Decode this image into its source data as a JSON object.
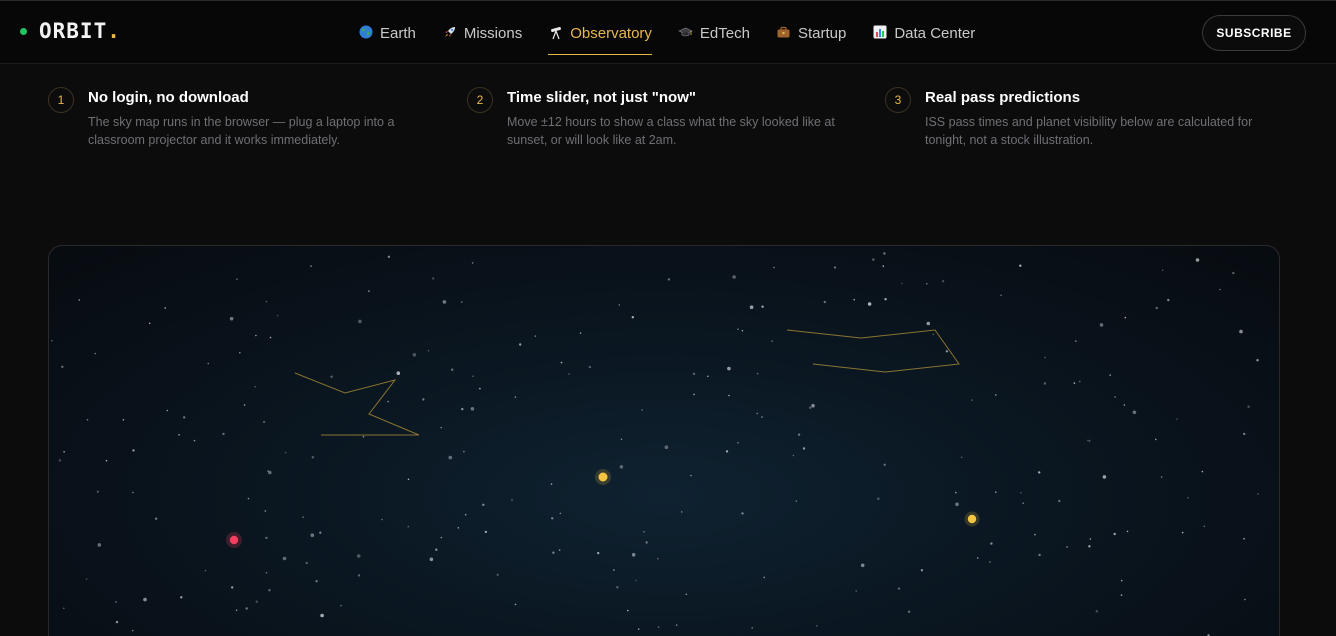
{
  "header": {
    "brand": "ORBIT",
    "brand_period": ".",
    "subscribe_label": "SUBSCRIBE"
  },
  "nav": {
    "items": [
      {
        "label": "Earth",
        "icon": "globe-icon",
        "active": false
      },
      {
        "label": "Missions",
        "icon": "rocket-icon",
        "active": false
      },
      {
        "label": "Observatory",
        "icon": "telescope-icon",
        "active": true
      },
      {
        "label": "EdTech",
        "icon": "graduation-cap-icon",
        "active": false
      },
      {
        "label": "Startup",
        "icon": "briefcase-icon",
        "active": false
      },
      {
        "label": "Data Center",
        "icon": "bar-chart-icon",
        "active": false
      }
    ]
  },
  "features": [
    {
      "number": "1",
      "title": "No login, no download",
      "description": "The sky map runs in the browser — plug a laptop into a classroom projector and it works immediately."
    },
    {
      "number": "2",
      "title": "Time slider, not just \"now\"",
      "description": "Move ±12 hours to show a class what the sky looked like at sunset, or will look like at 2am."
    },
    {
      "number": "3",
      "title": "Real pass predictions",
      "description": "ISS pass times and planet visibility below are calculated for tonight, not a stock illustration."
    }
  ],
  "skymap": {
    "colors": {
      "planet_yellow": "#f5c542",
      "planet_red": "#f43f5e",
      "constellation_line": "#8a7432",
      "star": "#b8bcc4"
    }
  }
}
